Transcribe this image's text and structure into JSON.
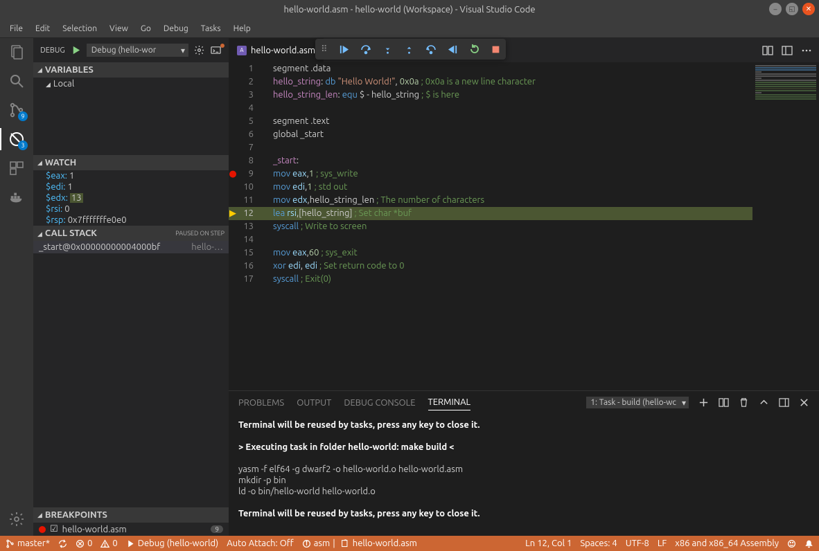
{
  "window": {
    "title": "hello-world.asm - hello-world (Workspace) - Visual Studio Code"
  },
  "menu": [
    "File",
    "Edit",
    "Selection",
    "View",
    "Go",
    "Debug",
    "Tasks",
    "Help"
  ],
  "activity": {
    "scm_badge": "9",
    "debug_badge": "3"
  },
  "sidebar": {
    "debug_label": "DEBUG",
    "config": "Debug (hello-wor",
    "sections": {
      "variables": "VARIABLES",
      "local": "Local",
      "watch": "WATCH",
      "callstack": "CALL STACK",
      "callstack_state": "PAUSED ON STEP",
      "breakpoints": "BREAKPOINTS"
    },
    "watch": [
      {
        "key": "$eax:",
        "val": " 1"
      },
      {
        "key": "$edi:",
        "val": " 1"
      },
      {
        "key": "$edx:",
        "val_hl": "13"
      },
      {
        "key": "$rsi:",
        "val": " 0"
      },
      {
        "key": "$rsp:",
        "val": " 0x7fffffffe0e0"
      }
    ],
    "callstack": [
      {
        "fn": "_start@0x00000000004000bf",
        "mod": "hello-…"
      }
    ],
    "breakpoints": [
      {
        "name": "hello-world.asm",
        "line": "9"
      }
    ]
  },
  "tab": {
    "name": "hello-world.asm"
  },
  "code": [
    {
      "n": 1,
      "html": "segment .data"
    },
    {
      "n": 2,
      "html": "    <span class='lbl'>hello_string</span><span class='op'>:</span> <span class='kw'>db</span> <span class='str'>\"Hello World!\"</span>, <span class='num'>0x0a</span>  <span class='cmt'>; 0x0a is a new line character</span>"
    },
    {
      "n": 3,
      "html": "    <span class='lbl'>hello_string_len</span><span class='op'>:</span> <span class='kw'>equ</span> $ - hello_string  <span class='cmt'>; $ is here</span>"
    },
    {
      "n": 4,
      "html": ""
    },
    {
      "n": 5,
      "html": "segment .text"
    },
    {
      "n": 6,
      "html": "global _start"
    },
    {
      "n": 7,
      "html": ""
    },
    {
      "n": 8,
      "html": "<span class='lbl'>_start</span><span class='op'>:</span>"
    },
    {
      "n": 9,
      "bp": "red",
      "html": "    <span class='kw'>mov</span> <span class='reg'>eax</span>,<span class='num'>1</span> <span class='cmt'>; sys_write</span>"
    },
    {
      "n": 10,
      "html": "    <span class='kw'>mov</span> <span class='reg'>edi</span>,<span class='num'>1</span> <span class='cmt'>; std out</span>"
    },
    {
      "n": 11,
      "html": "    <span class='kw'>mov</span> <span class='reg'>edx</span>,hello_string_len  <span class='cmt'>; The number of characters</span>"
    },
    {
      "n": 12,
      "bp": "yellow",
      "current": true,
      "html": "    <span class='kw'>lea</span> <span class='reg'>rsi</span>,[hello_string]  <span class='cmt'>; Set char *buf</span>"
    },
    {
      "n": 13,
      "html": "    <span class='kw'>syscall</span> <span class='cmt'>; Write to screen</span>"
    },
    {
      "n": 14,
      "html": ""
    },
    {
      "n": 15,
      "html": "    <span class='kw'>mov</span> <span class='reg'>eax</span>,<span class='num'>60</span> <span class='cmt'>; sys_exit</span>"
    },
    {
      "n": 16,
      "html": "    <span class='kw'>xor</span> <span class='reg'>edi</span>, <span class='reg'>edi</span> <span class='cmt'>; Set return code to 0</span>"
    },
    {
      "n": 17,
      "html": "    <span class='kw'>syscall</span>  <span class='cmt'>; Exit(0)</span>"
    }
  ],
  "panel": {
    "tabs": [
      "PROBLEMS",
      "OUTPUT",
      "DEBUG CONSOLE",
      "TERMINAL"
    ],
    "active_tab": 3,
    "term_select": "1: Task - build (hello-wc",
    "lines": [
      {
        "bold": true,
        "text": "Terminal will be reused by tasks, press any key to close it."
      },
      {
        "text": ""
      },
      {
        "bold": true,
        "text": "> Executing task in folder hello-world: make build <"
      },
      {
        "text": ""
      },
      {
        "text": "yasm -f elf64 -g dwarf2 -o hello-world.o hello-world.asm"
      },
      {
        "text": "mkdir -p bin"
      },
      {
        "text": "ld -o bin/hello-world hello-world.o"
      },
      {
        "text": ""
      },
      {
        "bold": true,
        "text": "Terminal will be reused by tasks, press any key to close it."
      }
    ]
  },
  "status": {
    "branch": "master*",
    "errors": "0",
    "warnings": "0",
    "debug": "Debug (hello-world)",
    "auto_attach": "Auto Attach: Off",
    "lang_zone": "asm",
    "file": "hello-world.asm",
    "pos": "Ln 12, Col 1",
    "spaces": "Spaces: 4",
    "encoding": "UTF-8",
    "eol": "LF",
    "language": "x86 and x86_64 Assembly"
  }
}
